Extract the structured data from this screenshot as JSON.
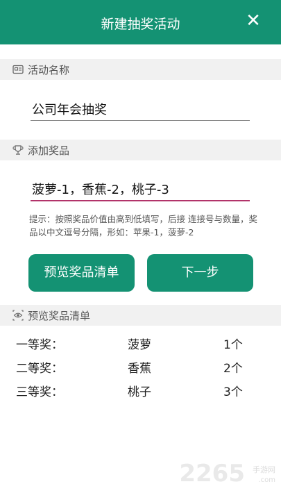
{
  "header": {
    "title": "新建抽奖活动",
    "close_icon": "close-icon"
  },
  "activity_section": {
    "label": "活动名称",
    "icon": "id-card-icon",
    "value": "公司年会抽奖"
  },
  "prize_section": {
    "label": "添加奖品",
    "icon": "trophy-icon",
    "value": "菠萝-1，香蕉-2，桃子-3",
    "hint": "提示：按照奖品价值由高到低填写，后接 连接号与数量，奖品以中文逗号分隔，形如：苹果-1，菠萝-2"
  },
  "buttons": {
    "preview": "预览奖品清单",
    "next": "下一步"
  },
  "preview_section": {
    "label": "预览奖品清单",
    "icon": "eye-icon",
    "rows": [
      {
        "level": "一等奖：",
        "prize": "菠萝",
        "count": "1个"
      },
      {
        "level": "二等奖：",
        "prize": "香蕉",
        "count": "2个"
      },
      {
        "level": "三等奖：",
        "prize": "桃子",
        "count": "3个"
      }
    ]
  },
  "watermark": {
    "number": "2265",
    "suffix": ".com",
    "site": "手游网"
  },
  "colors": {
    "primary": "#149273",
    "accent_underline": "#b2336a",
    "section_bg": "#f1f1f1"
  }
}
